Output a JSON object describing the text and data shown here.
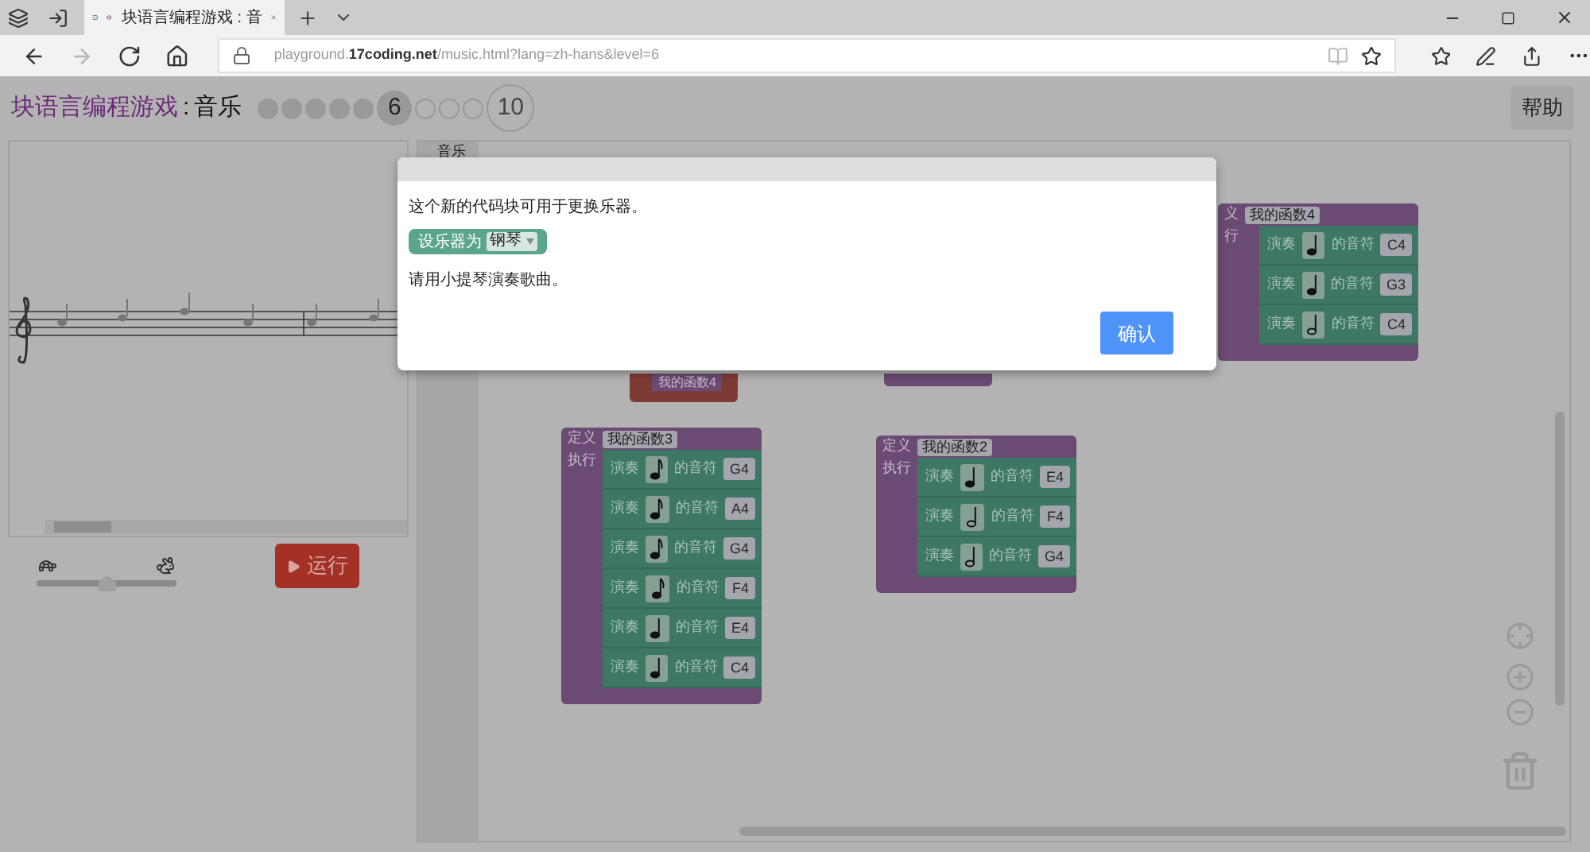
{
  "browser": {
    "tabs": [
      {
        "title": "块语言编程游戏 : 音",
        "selected": true
      }
    ],
    "nav": [
      {
        "kind": "back",
        "disabled": false
      },
      {
        "kind": "forward",
        "disabled": true
      },
      {
        "kind": "refresh",
        "disabled": false
      },
      {
        "kind": "home",
        "disabled": false
      }
    ],
    "url": [
      {
        "text": "playground.",
        "kind": "path"
      },
      {
        "text": "17coding.net",
        "kind": "domain"
      },
      {
        "text": "/music.html?lang=zh-hans&level=6",
        "kind": "path"
      }
    ]
  },
  "header": {
    "game_title": "块语言编程游戏",
    "separator": ":",
    "page_name": "音乐",
    "levels": [
      {
        "kind": "done"
      },
      {
        "kind": "done"
      },
      {
        "kind": "done"
      },
      {
        "kind": "done"
      },
      {
        "kind": "done"
      },
      {
        "kind": "current",
        "label": "6"
      },
      {
        "kind": "todo"
      },
      {
        "kind": "todo"
      },
      {
        "kind": "todo"
      },
      {
        "kind": "final",
        "label": "10"
      }
    ],
    "help_button": "帮助"
  },
  "controls": {
    "speed": {
      "level": 0.5
    },
    "run_button": "运行"
  },
  "toolbox": {
    "category": "音乐"
  },
  "blocks": [
    {
      "kind": "call",
      "name": "我的函数4"
    },
    {
      "kind": "stub"
    },
    {
      "kind": "define",
      "define_label": "定义",
      "name": "我的函数3",
      "do_label": "执行",
      "statements": [
        {
          "label": "演奏",
          "kind": "eighth",
          "text": "的音符",
          "pitch": "G4"
        },
        {
          "label": "演奏",
          "kind": "eighth",
          "text": "的音符",
          "pitch": "A4"
        },
        {
          "label": "演奏",
          "kind": "eighth",
          "text": "的音符",
          "pitch": "G4"
        },
        {
          "label": "演奏",
          "kind": "eighth",
          "text": "的音符",
          "pitch": "F4"
        },
        {
          "label": "演奏",
          "kind": "quarter",
          "text": "的音符",
          "pitch": "E4"
        },
        {
          "label": "演奏",
          "kind": "quarter",
          "text": "的音符",
          "pitch": "C4"
        }
      ]
    },
    {
      "kind": "define",
      "define_label": "定义",
      "name": "我的函数2",
      "do_label": "执行",
      "statements": [
        {
          "label": "演奏",
          "kind": "quarter",
          "text": "的音符",
          "pitch": "E4"
        },
        {
          "label": "演奏",
          "kind": "half",
          "text": "的音符",
          "pitch": "F4"
        },
        {
          "label": "演奏",
          "kind": "half",
          "text": "的音符",
          "pitch": "G4"
        }
      ]
    },
    {
      "kind": "define",
      "define_label": "义",
      "name": "我的函数4",
      "do_label": "行",
      "statements": [
        {
          "label": "演奏",
          "kind": "quarter",
          "text": "的音符",
          "pitch": "C4"
        },
        {
          "label": "演奏",
          "kind": "quarter",
          "text": "的音符",
          "pitch": "G3"
        },
        {
          "label": "演奏",
          "kind": "half",
          "text": "的音符",
          "pitch": "C4"
        }
      ]
    }
  ],
  "dialog": {
    "message": "这个新的代码块可用于更换乐器。",
    "example_block": {
      "label": "设乐器为",
      "value": "钢琴"
    },
    "instruction": "请用小提琴演奏歌曲。",
    "confirm_button": "确认"
  }
}
